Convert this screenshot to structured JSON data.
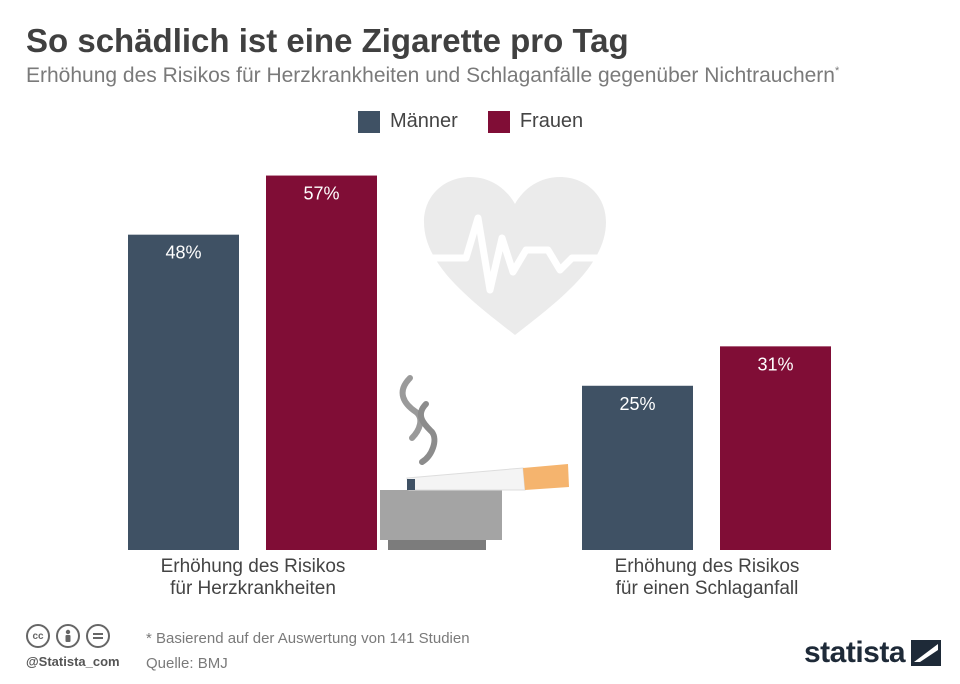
{
  "title": "So schädlich ist eine Zigarette pro Tag",
  "subtitle": "Erhöhung des Risikos für Herzkrankheiten und Schlaganfälle gegenüber Nichtrauchern",
  "subtitle_mark": "*",
  "colors": {
    "maenner": "#3f5164",
    "frauen": "#800d36",
    "icon": "#ebebeb"
  },
  "chart_data": {
    "type": "bar",
    "categories": [
      [
        "Erhöhung des Risikos",
        "für Herzkrankheiten"
      ],
      [
        "Erhöhung des Risikos",
        "für einen Schlaganfall"
      ]
    ],
    "series": [
      {
        "name": "Männer",
        "values": [
          48,
          31
        ],
        "labels": [
          "48%",
          "25%"
        ]
      },
      {
        "name": "Frauen",
        "values": [
          57,
          31
        ],
        "labels": [
          "57%",
          "31%"
        ]
      }
    ],
    "ylim": [
      0,
      65
    ],
    "legend_position": "top-center"
  },
  "legend": {
    "maenner": "Männer",
    "frauen": "Frauen"
  },
  "footer": {
    "note": "* Basierend auf der Auswertung von 141 Studien",
    "source": "Quelle: BMJ",
    "handle": "@Statista_com",
    "brand": "statista"
  },
  "icons": [
    "heart-icon",
    "cigarette-ashtray-icon",
    "cc-icon",
    "by-icon",
    "nd-icon",
    "statista-logo-icon"
  ]
}
